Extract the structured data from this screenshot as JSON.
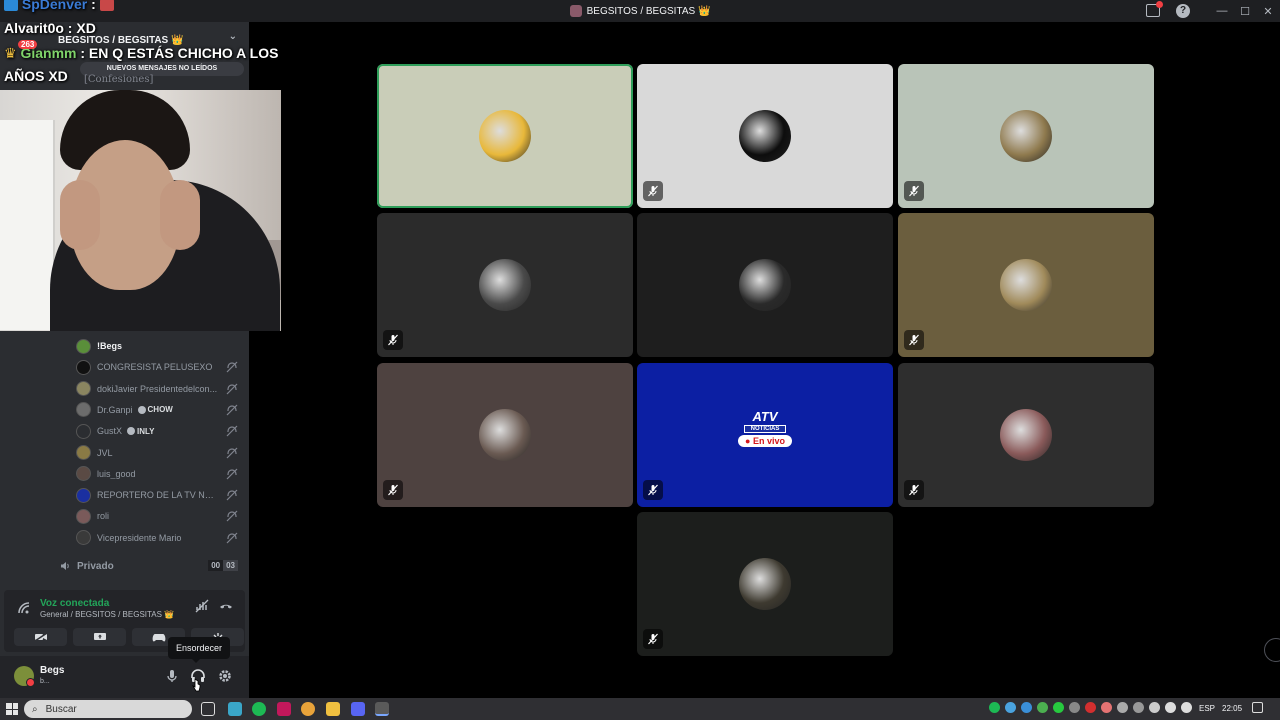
{
  "window": {
    "title": "BEGSITOS / BEGSITAS 👑"
  },
  "chat_overlay": {
    "line1_user": "SpDenver",
    "line1_sep": " :",
    "line2_user": "Alvarit0o",
    "line2_text": " : XD",
    "line3_user": "Gianmm",
    "line3_text": " : EN Q ESTÁS CHICHO A LOS",
    "line4_text": "AÑOS XD",
    "notif_count": "263"
  },
  "server": {
    "name": "BEGSITOS / BEGSITAS 👑",
    "unread_pill": "NUEVOS MENSAJES NO LEÍDOS",
    "channel_confesiones": "[Confesiones]"
  },
  "members": [
    {
      "name": "!Begs",
      "live": true,
      "color": "#5a8f3a"
    },
    {
      "name": "CONGRESISTA PELUSEXO",
      "color": "#111111"
    },
    {
      "name": "dokiJavier Presidentedelcon...",
      "color": "#8a8560"
    },
    {
      "name": "Dr.Ganpi",
      "tag": "CHOW",
      "color": "#6c6c6c"
    },
    {
      "name": "GustX",
      "tag": "INLY",
      "color": "#2b2d31"
    },
    {
      "name": "JVL",
      "color": "#8a7a45"
    },
    {
      "name": "luis_good",
      "color": "#5a4a44"
    },
    {
      "name": "REPORTERO DE LA TV NOT...",
      "color": "#1a2fa0"
    },
    {
      "name": "roli",
      "color": "#7a5a5a"
    },
    {
      "name": "Vicepresidente Mario",
      "color": "#3a3a3a"
    }
  ],
  "private_channel": {
    "name": "Privado",
    "count_a": "00",
    "count_b": "03"
  },
  "voice": {
    "status": "Voz conectada",
    "location": "General / BEGSITOS / BEGSITAS 👑"
  },
  "tooltip": "Ensordecer",
  "user": {
    "name": "Begs",
    "status": "b..."
  },
  "tiles": [
    {
      "name": "tile-1",
      "bg": "#c9cdb8",
      "avatar": "#e8b83a",
      "speaking": true,
      "muted": false
    },
    {
      "name": "tile-2",
      "bg": "#d9d9d9",
      "avatar": "#0d0d0d",
      "muted": true
    },
    {
      "name": "tile-3",
      "bg": "#b9c4b8",
      "avatar": "#8f7a4e",
      "muted": true
    },
    {
      "name": "tile-4",
      "bg": "#2b2b2b",
      "avatar": "#4a4a4a",
      "muted": true
    },
    {
      "name": "tile-5",
      "bg": "#1e1e1e",
      "avatar": "#2a2a2a",
      "muted": false
    },
    {
      "name": "tile-6",
      "bg": "#6b5e3e",
      "avatar": "#a08a5a",
      "muted": true
    },
    {
      "name": "tile-7",
      "bg": "#4e4240",
      "avatar": "#6a5a52",
      "muted": true
    },
    {
      "name": "tile-8",
      "bg": "#0c1fa3",
      "live": true,
      "muted": true
    },
    {
      "name": "tile-9",
      "bg": "#2e2e2e",
      "avatar": "#8a5a5a",
      "muted": true
    },
    {
      "name": "tile-10",
      "bg": "#1c1e1c",
      "avatar": "#3e3a30",
      "muted": true
    }
  ],
  "live_logo": {
    "brand": "ATV",
    "sub": "NOTICIAS",
    "badge": "En vivo"
  },
  "taskbar": {
    "search_placeholder": "Buscar",
    "lang": "ESP",
    "time": "22:05"
  }
}
